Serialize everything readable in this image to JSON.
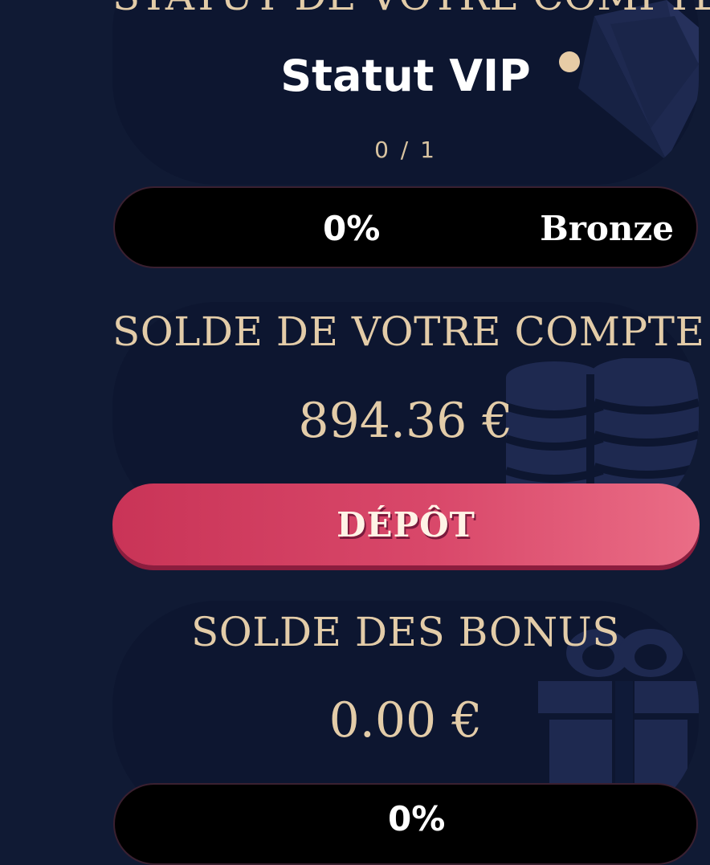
{
  "vip_section": {
    "title": "STATUT DE VOTRE COMPTE:",
    "status_label": "Statut VIP",
    "count": "0 / 1",
    "progress": {
      "percent_label": "0%",
      "percent": 0,
      "level": "Bronze"
    }
  },
  "balance_section": {
    "title": "SOLDE DE VOTRE COMPTE",
    "amount": "894.36 €",
    "deposit_label": "DÉPÔT"
  },
  "bonus_section": {
    "title": "SOLDE DES BONUS",
    "amount": "0.00 €",
    "progress": {
      "percent_label": "0%",
      "percent": 0
    }
  },
  "icons": [
    "diamond-icon",
    "coins-icon",
    "gift-icon"
  ],
  "colors": {
    "background": "#101a34",
    "panel": "#0d1630",
    "gold": "#e3cca8",
    "deposit_start": "#c93457",
    "deposit_end": "#ea6d86"
  }
}
